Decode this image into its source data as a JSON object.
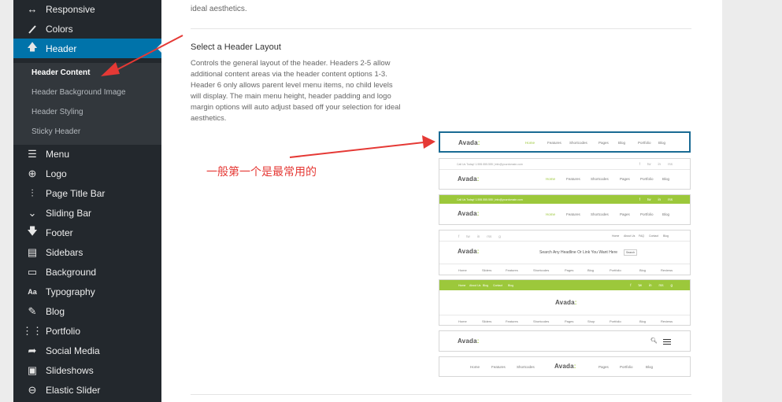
{
  "sidebar": {
    "items": [
      {
        "label": "Responsive",
        "icon": "arrows-horizontal-icon"
      },
      {
        "label": "Colors",
        "icon": "brush-icon"
      },
      {
        "label": "Header",
        "icon": "arrow-up-icon"
      },
      {
        "label": "Menu",
        "icon": "menu-lines-icon"
      },
      {
        "label": "Logo",
        "icon": "plus-circle-icon"
      },
      {
        "label": "Page Title Bar",
        "icon": "sliders-icon"
      },
      {
        "label": "Sliding Bar",
        "icon": "chevron-down-icon"
      },
      {
        "label": "Footer",
        "icon": "arrow-down-icon"
      },
      {
        "label": "Sidebars",
        "icon": "sidebar-icon"
      },
      {
        "label": "Background",
        "icon": "monitor-icon"
      },
      {
        "label": "Typography",
        "icon": "typography-icon"
      },
      {
        "label": "Blog",
        "icon": "edit-icon"
      },
      {
        "label": "Portfolio",
        "icon": "grid-icon"
      },
      {
        "label": "Social Media",
        "icon": "share-icon"
      },
      {
        "label": "Slideshows",
        "icon": "image-icon"
      },
      {
        "label": "Elastic Slider",
        "icon": "minus-circle-icon"
      }
    ],
    "active_item": "Header",
    "subitems": [
      {
        "label": "Header Content"
      },
      {
        "label": "Header Background Image"
      },
      {
        "label": "Header Styling"
      },
      {
        "label": "Sticky Header"
      }
    ],
    "current_subitem": "Header Content"
  },
  "panel": {
    "intro_tail": "ideal aesthetics.",
    "section_title": "Select a Header Layout",
    "section_desc": "Controls the general layout of the header. Headers 2-5 allow additional content areas via the header content options 1-3. Header 6 only allows parent level menu items, no child levels will display. The main menu height, header padding and logo margin options will auto adjust based off your selection for ideal aesthetics."
  },
  "layouts": {
    "logo_text": "Avada",
    "logo_accent": ":",
    "nav_main": [
      "Home",
      "Features",
      "Shortcodes",
      "Pages",
      "Blog",
      "Portfolio",
      "Blog"
    ],
    "nav_long": [
      "Home",
      "Sliders",
      "Features",
      "Shortcodes",
      "Pages",
      "Blog",
      "Portfolio",
      "Blog",
      "Reviews"
    ],
    "nav_long_shop": [
      "Home",
      "Sliders",
      "Features",
      "Shortcodes",
      "Pages",
      "Shop",
      "Portfolio",
      "Blog",
      "Reviews"
    ],
    "nav_split_left": [
      "Home",
      "Features",
      "Shortcodes"
    ],
    "nav_split_right": [
      "Pages",
      "Portfolio",
      "Blog"
    ],
    "nav_top_right": [
      "Home",
      "About Us",
      "FAQ",
      "Contact",
      "Blog"
    ],
    "nav_top_left": [
      "Home",
      "About Us",
      "Blog",
      "Contact",
      "Blog"
    ],
    "contact_text": "Call Us Today! 1.555.555.555 | info@yourdomain.com",
    "tagline": "Search Any Headline Or Link You Want Here",
    "search_btn": "Search",
    "social_icons": [
      "f",
      "tw",
      "in",
      "rss",
      "g"
    ],
    "accent_color": "#9cc83b",
    "selected_index": 0
  },
  "annotation": {
    "text": "一般第一个是最常用的",
    "color": "#e53935"
  }
}
